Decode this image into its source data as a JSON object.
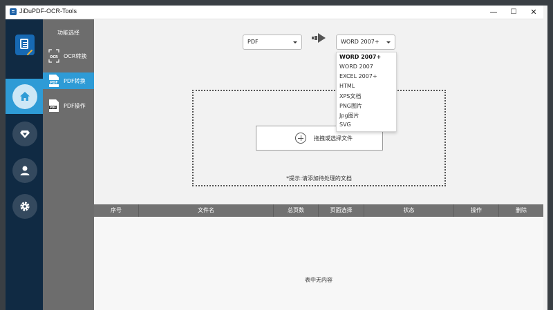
{
  "window": {
    "title": "JiDuPDF-OCR-Tools",
    "controls": {
      "minimize": "—",
      "maximize": "☐",
      "close": "✕"
    }
  },
  "nav": {
    "items": [
      {
        "id": "home",
        "icon": "home-icon",
        "active": true
      },
      {
        "id": "vip",
        "icon": "diamond-icon",
        "active": false
      },
      {
        "id": "user",
        "icon": "user-icon",
        "active": false
      },
      {
        "id": "settings",
        "icon": "gear-icon",
        "active": false
      }
    ]
  },
  "subnav": {
    "title": "功能选择",
    "items": [
      {
        "label": "OCR转换",
        "icon": "ocr-icon",
        "active": false
      },
      {
        "label": "PDF转换",
        "icon": "pdf-convert-icon",
        "active": true
      },
      {
        "label": "PDF操作",
        "icon": "pdf-operate-icon",
        "active": false
      }
    ]
  },
  "converter": {
    "source_format": "PDF",
    "target_format": "WORD 2007+",
    "target_options": [
      "WORD 2007+",
      "WORD 2007",
      "EXCEL 2007+",
      "HTML",
      "XPS文档",
      "PNG图片",
      "Jpg图片",
      "SVG"
    ]
  },
  "dropzone": {
    "add_file_label": "拖拽或选择文件",
    "hint": "*提示:请添加待处理的文档"
  },
  "table": {
    "columns": [
      "序号",
      "文件名",
      "总页数",
      "页面选择",
      "状态",
      "操作",
      "删除"
    ],
    "rows": [],
    "empty_text": "表中无内容"
  },
  "colors": {
    "nav_bg": "#102a43",
    "accent": "#2e9bd6",
    "subnav_bg": "#6d6d6d",
    "table_header_bg": "#727272"
  }
}
